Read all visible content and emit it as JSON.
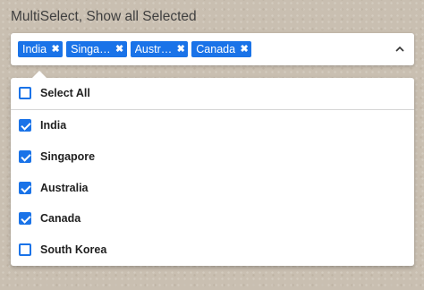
{
  "title": "MultiSelect, Show all Selected",
  "selected_tags": [
    {
      "label": "India",
      "remove_icon": "close-icon"
    },
    {
      "label": "Singa…",
      "remove_icon": "close-icon"
    },
    {
      "label": "Austr…",
      "remove_icon": "close-icon"
    },
    {
      "label": "Canada",
      "remove_icon": "close-icon"
    }
  ],
  "toggle_icon": "chevron-up-icon",
  "dropdown": {
    "select_all": {
      "label": "Select All",
      "checked": false
    },
    "options": [
      {
        "label": "India",
        "checked": true
      },
      {
        "label": "Singapore",
        "checked": true
      },
      {
        "label": "Australia",
        "checked": true
      },
      {
        "label": "Canada",
        "checked": true
      },
      {
        "label": "South Korea",
        "checked": false
      }
    ]
  },
  "colors": {
    "accent": "#1a73e8",
    "background": "#c9bfb1",
    "title_text": "#3f3f3f"
  }
}
